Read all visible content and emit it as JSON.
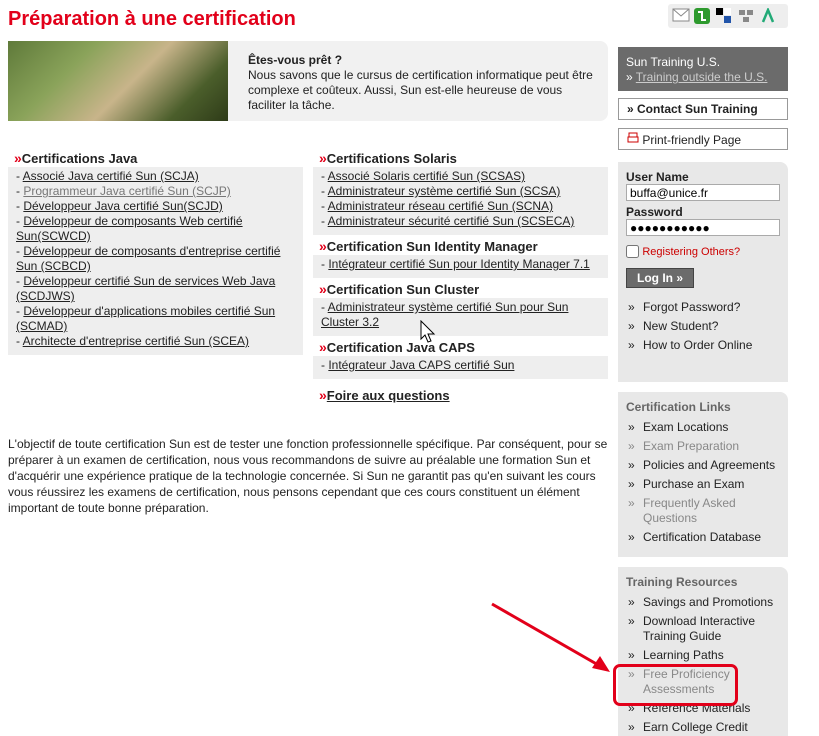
{
  "page_title": "Préparation à une certification",
  "hero": {
    "heading": "Êtes-vous prêt ?",
    "text": "Nous savons que le cursus de certification informatique peut être complexe et coûteux. Aussi, Sun est-elle heureuse de vous faciliter la tâche."
  },
  "java": {
    "heading": "Certifications Java",
    "items": [
      "Associé Java certifié Sun (SCJA)",
      "Programmeur Java certifié Sun (SCJP)",
      "Développeur Java certifié Sun(SCJD)",
      "Développeur de composants Web certifié Sun(SCWCD)",
      "Développeur de composants d'entreprise certifié Sun (SCBCD)",
      "Développeur certifié Sun de services Web Java (SCDJWS)",
      "Développeur d'applications mobiles certifié Sun (SCMAD)",
      "Architecte d'entreprise certifié Sun (SCEA)"
    ]
  },
  "solaris": {
    "heading": "Certifications Solaris",
    "items": [
      "Associé Solaris certifié Sun (SCSAS)",
      "Administrateur système certifié Sun (SCSA)",
      "Administrateur réseau certifié Sun (SCNA)",
      "Administrateur sécurité certifié Sun (SCSECA)"
    ]
  },
  "identity": {
    "heading": "Certification Sun Identity Manager",
    "items": [
      "Intégrateur certifié Sun pour Identity Manager 7.1"
    ]
  },
  "cluster": {
    "heading": "Certification Sun Cluster",
    "items": [
      "Administrateur système certifié Sun pour Sun Cluster 3.2"
    ]
  },
  "caps": {
    "heading": "Certification Java CAPS",
    "items": [
      "Intégrateur Java CAPS certifié Sun"
    ]
  },
  "faq": "Foire aux questions",
  "paragraph": "L'objectif de toute certification Sun est de tester une fonction professionnelle spécifique. Par conséquent, pour se préparer à un examen de certification, nous vous recommandons de suivre au préalable une formation Sun et d'acquérir une expérience pratique de la technologie concernée. Si Sun ne garantit pas qu'en suivant les cours vous réussirez les examens de certification, nous pensons cependant que ces cours constituent un élément important de toute bonne préparation.",
  "sidebar": {
    "region_title": "Sun Training U.S.",
    "region_link": "Training outside the U.S.",
    "contact": "Contact Sun Training",
    "print": "Print-friendly Page",
    "login": {
      "user_label": "User Name",
      "user_value": "buffa@unice.fr",
      "password_label": "Password",
      "password_value": "●●●●●●●●●●●",
      "registering": "Registering Others?",
      "login_button": "Log In »",
      "links": [
        "Forgot Password?",
        "New Student?",
        "How to Order Online"
      ]
    },
    "cert_links": {
      "heading": "Certification Links",
      "items": [
        "Exam Locations",
        "Exam Preparation",
        "Policies and Agreements",
        "Purchase an Exam",
        "Frequently Asked Questions",
        "Certification Database"
      ]
    },
    "training": {
      "heading": "Training Resources",
      "items": [
        "Savings and Promotions",
        "Download Interactive Training Guide",
        "Learning Paths",
        "Free Proficiency Assessments",
        "Reference Materials",
        "Earn College Credit"
      ]
    }
  },
  "colors": {
    "accent": "#e2001a",
    "panel": "#e8e8e8",
    "dark": "#6b6b6b"
  },
  "icons": [
    "email-icon",
    "share-icon",
    "bookmark-icon",
    "network-icon",
    "digg-icon",
    "printer-icon",
    "red-arrow-icon",
    "mouse-cursor-icon"
  ]
}
